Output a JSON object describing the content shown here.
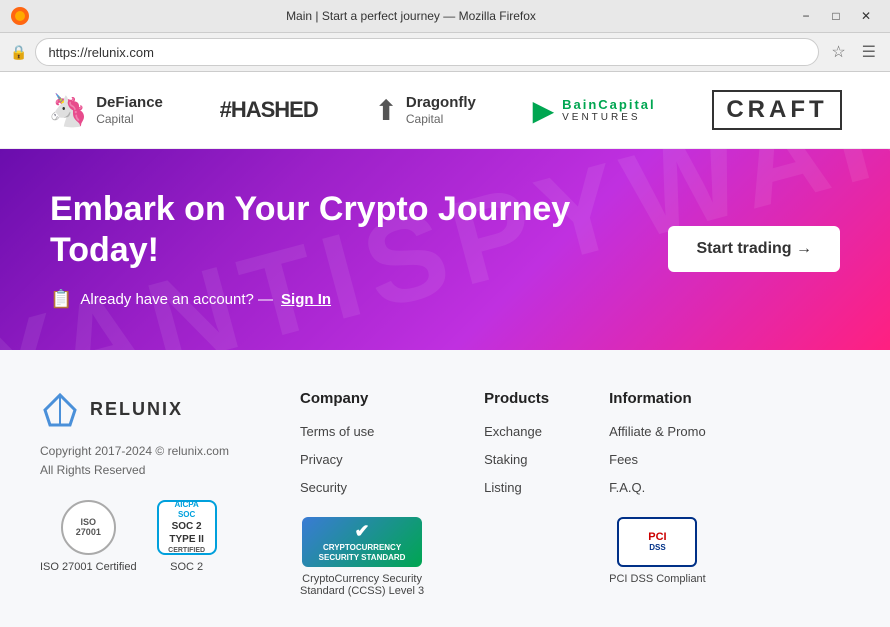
{
  "browser": {
    "title": "Main | Start a perfect journey — Mozilla Firefox",
    "url": "https://relunix.com",
    "minimize_label": "−",
    "maximize_label": "□",
    "close_label": "✕"
  },
  "partners": [
    {
      "id": "defiance",
      "name": "DeFiance",
      "sub": "Capital",
      "type": "icon-text"
    },
    {
      "id": "hashed",
      "name": "#HASHED",
      "type": "text-only"
    },
    {
      "id": "dragonfly",
      "name": "Dragonfly",
      "sub": "Capital",
      "type": "icon-text"
    },
    {
      "id": "bain",
      "name": "BainCapital",
      "sub": "VENTURES",
      "type": "special"
    },
    {
      "id": "craft",
      "name": "CRAFT",
      "type": "boxed"
    }
  ],
  "hero": {
    "title": "Embark on Your Crypto Journey Today!",
    "signin_text": "Already have an account? —",
    "signin_link": "Sign In",
    "cta_label": "Start trading →",
    "watermark": "MYANTISPYWARE"
  },
  "footer": {
    "logo_name": "RELUNIX",
    "copyright": "Copyright 2017-2024 © relunix.com",
    "rights": "All Rights Reserved",
    "cert_iso_label": "ISO 27001 Certified",
    "cert_soc_label": "SOC 2",
    "ccss_text": "CRYPTOCURRENCY\nSECURITY STANDARD",
    "ccss_label": "CryptoCurrency Security\nStandard (CCSS) Level 3",
    "pci_label": "PCI DSS Compliant",
    "columns": [
      {
        "id": "company",
        "heading": "Company",
        "links": [
          "Terms of use",
          "Privacy",
          "Security"
        ]
      },
      {
        "id": "products",
        "heading": "Products",
        "links": [
          "Exchange",
          "Staking",
          "Listing"
        ]
      },
      {
        "id": "information",
        "heading": "Information",
        "links": [
          "Affiliate & Promo",
          "Fees",
          "F.A.Q."
        ]
      }
    ]
  }
}
